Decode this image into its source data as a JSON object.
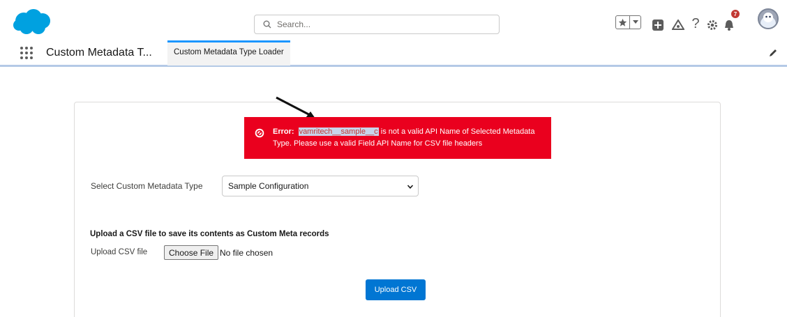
{
  "header": {
    "search_placeholder": "Search...",
    "notification_count": "7",
    "brand_color": "#00a1e0"
  },
  "nav": {
    "app_name": "Custom Metadata T...",
    "active_tab": "Custom Metadata Type Loader"
  },
  "error": {
    "label": "Error:",
    "highlighted": "vamritech__sample__c",
    "message_line1": " is not a valid API Name of Selected Metadata",
    "message_line2": "Type. Please use a valid Field API Name for CSV file headers",
    "color": "#ea001e"
  },
  "form": {
    "select_label": "Select Custom Metadata Type",
    "select_value": "Sample Configuration",
    "upload_heading": "Upload a CSV file to save its contents as Custom Meta records",
    "file_label": "Upload CSV file",
    "choose_file_label": "Choose File",
    "no_file_text": "No file chosen",
    "upload_button_label": "Upload CSV"
  }
}
